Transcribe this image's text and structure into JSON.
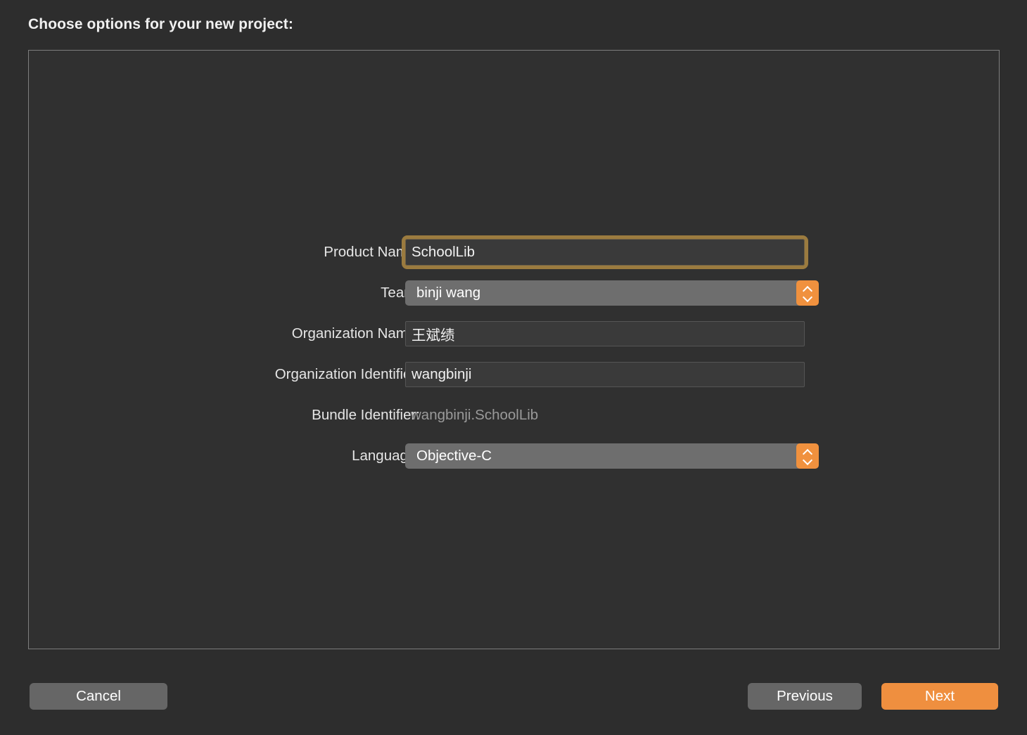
{
  "sheet": {
    "title": "Choose options for your new project:"
  },
  "form": {
    "rows": [
      {
        "label": "Product Name:",
        "type": "text",
        "value": "SchoolLib",
        "focused": true,
        "name": "product-name"
      },
      {
        "label": "Team:",
        "type": "popup",
        "value": "binji wang",
        "name": "team"
      },
      {
        "label": "Organization Name:",
        "type": "text",
        "value": "王斌绩",
        "focused": false,
        "name": "organization-name"
      },
      {
        "label": "Organization Identifier:",
        "type": "text",
        "value": "wangbinji",
        "focused": false,
        "name": "organization-identifier"
      },
      {
        "label": "Bundle Identifier:",
        "type": "static",
        "value": "wangbinji.SchoolLib",
        "name": "bundle-identifier"
      },
      {
        "label": "Language:",
        "type": "popup",
        "value": "Objective-C",
        "name": "language"
      }
    ]
  },
  "buttons": {
    "cancel": "Cancel",
    "previous": "Previous",
    "next": "Next"
  },
  "colors": {
    "window_background": "#2d2d2d",
    "panel_background": "#303030",
    "panel_border": "#7d7d7d",
    "accent_orange": "#ef8f3f",
    "stepper_orange": "#f0913e",
    "focus_ring": "#9b7b3f",
    "popup_fill": "#6e6e6e",
    "button_grey": "#666666",
    "text_primary": "#f0f0f0",
    "text_disabled": "#9a9a9a"
  },
  "icons": {
    "stepper_up": "chevron-up-icon",
    "stepper_down": "chevron-down-icon"
  }
}
